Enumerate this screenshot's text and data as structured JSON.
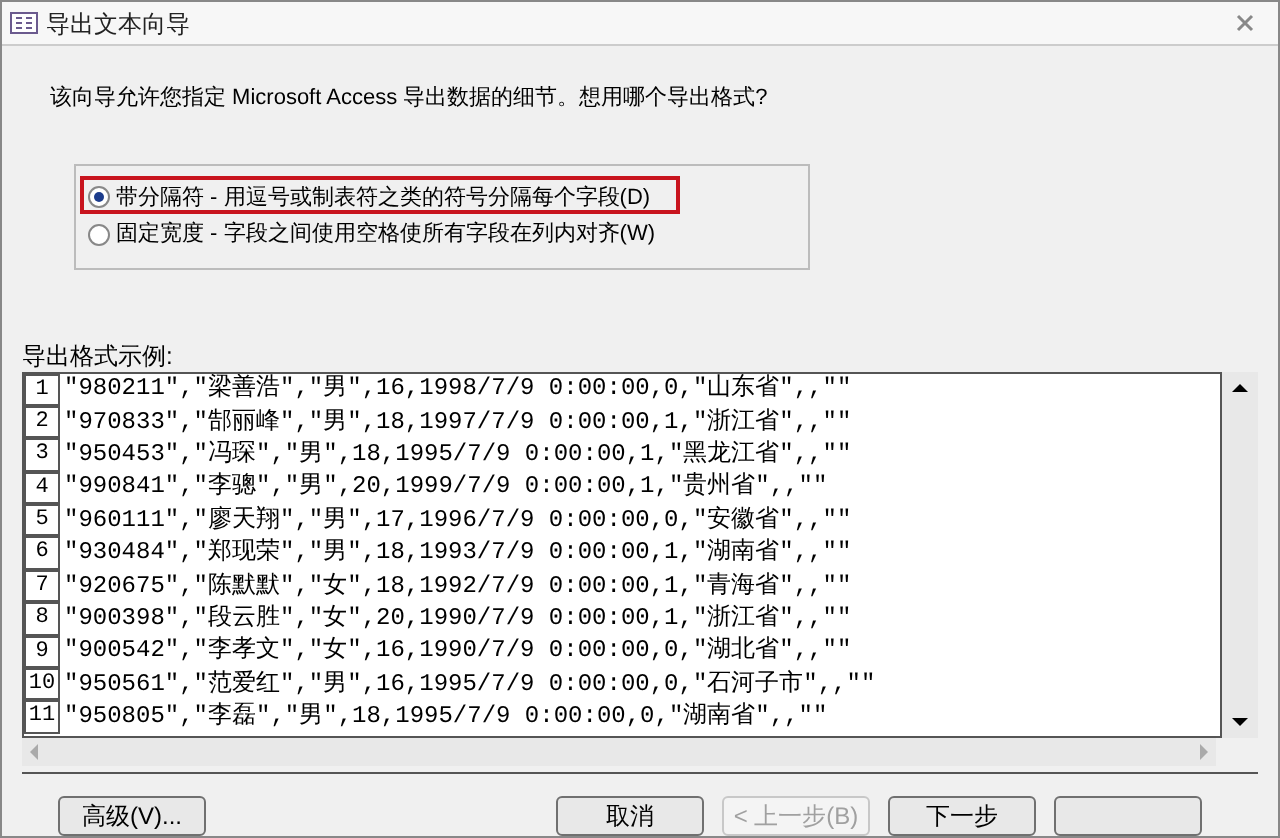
{
  "window": {
    "title": "导出文本向导"
  },
  "intro": "该向导允许您指定 Microsoft Access 导出数据的细节。想用哪个导出格式?",
  "format_options": [
    {
      "label": "带分隔符 - 用逗号或制表符之类的符号分隔每个字段(D)",
      "selected": true
    },
    {
      "label": "固定宽度 - 字段之间使用空格使所有字段在列内对齐(W)",
      "selected": false
    }
  ],
  "preview": {
    "label": "导出格式示例:",
    "rows": [
      {
        "number": "1",
        "text": "\"980211\",\"梁善浩\",\"男\",16,1998/7/9 0:00:00,0,\"山东省\",,\"\""
      },
      {
        "number": "2",
        "text": "\"970833\",\"郜丽峰\",\"男\",18,1997/7/9 0:00:00,1,\"浙江省\",,\"\""
      },
      {
        "number": "3",
        "text": "\"950453\",\"冯琛\",\"男\",18,1995/7/9 0:00:00,1,\"黑龙江省\",,\"\""
      },
      {
        "number": "4",
        "text": "\"990841\",\"李骢\",\"男\",20,1999/7/9 0:00:00,1,\"贵州省\",,\"\""
      },
      {
        "number": "5",
        "text": "\"960111\",\"廖天翔\",\"男\",17,1996/7/9 0:00:00,0,\"安徽省\",,\"\""
      },
      {
        "number": "6",
        "text": "\"930484\",\"郑现荣\",\"男\",18,1993/7/9 0:00:00,1,\"湖南省\",,\"\""
      },
      {
        "number": "7",
        "text": "\"920675\",\"陈默默\",\"女\",18,1992/7/9 0:00:00,1,\"青海省\",,\"\""
      },
      {
        "number": "8",
        "text": "\"900398\",\"段云胜\",\"女\",20,1990/7/9 0:00:00,1,\"浙江省\",,\"\""
      },
      {
        "number": "9",
        "text": "\"900542\",\"李孝文\",\"女\",16,1990/7/9 0:00:00,0,\"湖北省\",,\"\""
      },
      {
        "number": "10",
        "text": "\"950561\",\"范爱红\",\"男\",16,1995/7/9 0:00:00,0,\"石河子市\",,\"\""
      },
      {
        "number": "11",
        "text": "\"950805\",\"李磊\",\"男\",18,1995/7/9 0:00:00,0,\"湖南省\",,\"\""
      }
    ]
  },
  "buttons": [
    {
      "label": "高级(V)...",
      "disabled": false,
      "kind": "left"
    },
    {
      "label": "取消",
      "disabled": false,
      "kind": "right"
    },
    {
      "label": "< 上一步(B)",
      "disabled": true,
      "kind": "right"
    },
    {
      "label": "下一步",
      "disabled": false,
      "kind": "right"
    },
    {
      "disabled": false,
      "kind": "right"
    }
  ]
}
